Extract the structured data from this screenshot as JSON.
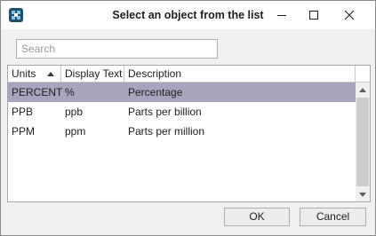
{
  "window": {
    "title": "Select an object from the list",
    "icon": "app-logo-icon"
  },
  "search": {
    "placeholder": "Search",
    "value": ""
  },
  "table": {
    "columns": [
      "Units",
      "Display Text",
      "Description"
    ],
    "sort_column": "Units",
    "sort_direction": "ascending",
    "rows": [
      {
        "units": "PERCENT",
        "display": "%",
        "description": "Percentage",
        "selected": true
      },
      {
        "units": "PPB",
        "display": "ppb",
        "description": "Parts per billion",
        "selected": false
      },
      {
        "units": "PPM",
        "display": "ppm",
        "description": "Parts per million",
        "selected": false
      }
    ]
  },
  "buttons": {
    "ok": "OK",
    "cancel": "Cancel"
  },
  "colors": {
    "selected_row": "#a8a4be",
    "app_icon": "#1f4e6b"
  }
}
